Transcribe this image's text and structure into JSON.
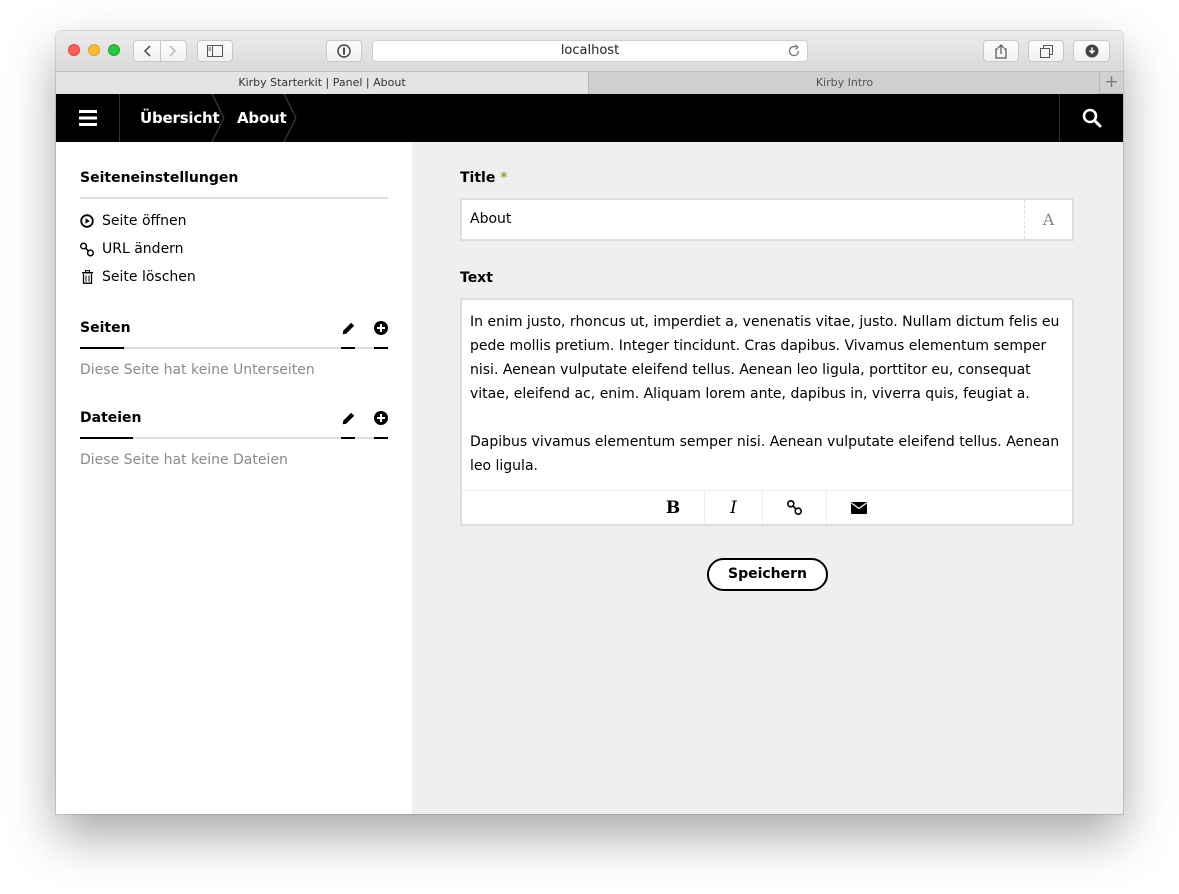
{
  "browser": {
    "url": "localhost",
    "tabs": [
      {
        "label": "Kirby Starterkit | Panel | About"
      },
      {
        "label": "Kirby Intro"
      }
    ],
    "new_tab_label": "+"
  },
  "topbar": {
    "breadcrumbs": [
      {
        "label": "Übersicht"
      },
      {
        "label": "About"
      }
    ]
  },
  "sidebar": {
    "settings_heading": "Seiteneinstellungen",
    "settings_links": [
      {
        "label": "Seite öffnen",
        "icon": "play-circle-icon"
      },
      {
        "label": "URL ändern",
        "icon": "link-icon"
      },
      {
        "label": "Seite löschen",
        "icon": "trash-icon"
      }
    ],
    "pages_heading": "Seiten",
    "pages_empty": "Diese Seite hat keine Unterseiten",
    "files_heading": "Dateien",
    "files_empty": "Diese Seite hat keine Dateien"
  },
  "form": {
    "title_label": "Title",
    "title_required_marker": "*",
    "title_value": "About",
    "title_icon_glyph": "A",
    "text_label": "Text",
    "text_paragraphs": [
      "In enim justo, rhoncus ut, imperdiet a, venenatis vitae, justo. Nullam dictum felis eu pede mollis pretium. Integer tincidunt. Cras dapibus. Vivamus elementum semper nisi. Aenean vulputate eleifend tellus. Aenean leo ligula, porttitor eu, consequat vitae, eleifend ac, enim. Aliquam lorem ante, dapibus in, viverra quis, feugiat a.",
      "Dapibus vivamus elementum semper nisi. Aenean vulputate eleifend tellus. Aenean leo ligula."
    ],
    "toolbar": {
      "bold_glyph": "B",
      "italic_glyph": "I"
    },
    "save_label": "Speichern"
  }
}
